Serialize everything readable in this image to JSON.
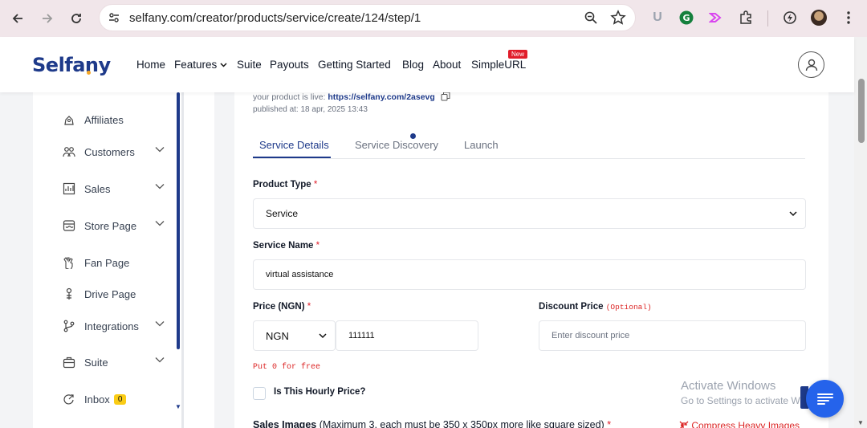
{
  "browser": {
    "url": "selfany.com/creator/products/service/create/124/step/1"
  },
  "header": {
    "logo": "Selfany",
    "nav": [
      "Home",
      "Features",
      "Suite",
      "Payouts",
      "Getting Started",
      "Blog",
      "About",
      "SimpleURL"
    ],
    "new_badge": "New"
  },
  "sidebar": {
    "items": [
      {
        "label": "Affiliates",
        "icon": "affiliates-icon"
      },
      {
        "label": "Customers",
        "icon": "customers-icon"
      },
      {
        "label": "Sales",
        "icon": "sales-icon"
      },
      {
        "label": "Store Page",
        "icon": "store-icon"
      },
      {
        "label": "Fan Page",
        "icon": "fan-icon"
      },
      {
        "label": "Drive Page",
        "icon": "drive-icon"
      },
      {
        "label": "Integrations",
        "icon": "integrations-icon"
      },
      {
        "label": "Suite",
        "icon": "suite-icon"
      },
      {
        "label": "Inbox",
        "icon": "inbox-icon",
        "badge": "0"
      }
    ]
  },
  "product": {
    "live_prefix": "your product is live: ",
    "live_link": "https://selfany.com/2asevg",
    "published": "published at: 18 apr, 2025 13:43"
  },
  "tabs": [
    "Service Details",
    "Service Discovery",
    "Launch"
  ],
  "form": {
    "product_type_label": "Product Type",
    "product_type_value": "Service",
    "service_name_label": "Service Name",
    "service_name_value": "virtual assistance",
    "price_label": "Price (NGN)",
    "currency_value": "NGN",
    "price_value": "111111",
    "discount_label": "Discount Price",
    "discount_optional": "(Optional)",
    "discount_placeholder": "Enter discount price",
    "free_hint": "Put 0 for free",
    "hourly_label": "Is This Hourly Price?",
    "sales_images_label": "Sales Images",
    "sales_images_hint": "(Maximum 3, each must be 350 x 350px more like square sized)",
    "compress_link": "Compress Heavy Images",
    "required_mark": "*"
  },
  "watermark": {
    "line1": "Activate Windows",
    "line2": "Go to Settings to activate Windows."
  }
}
